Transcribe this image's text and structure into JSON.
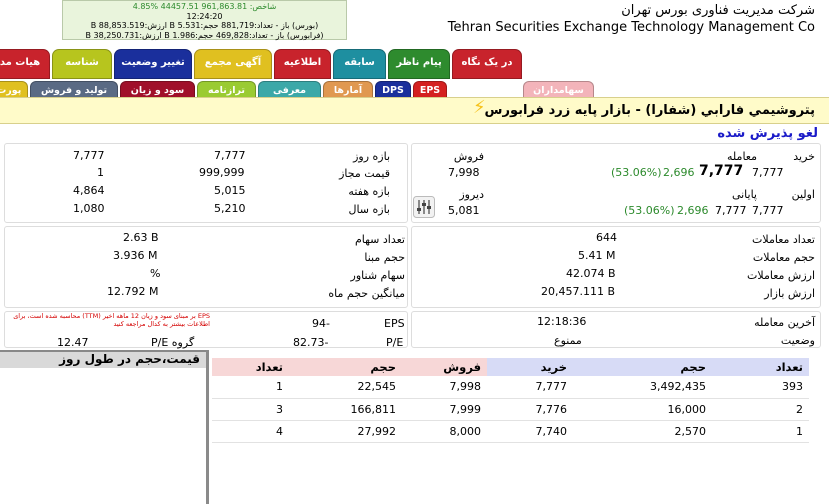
{
  "header": {
    "stats_line1": "شاخص: 961,863.81 44457.51 %4.85",
    "stats_line2": "12:24:20",
    "stats_line3": "(بورس) باز - تعداد:881,719 حجم:5.531 B ارزش:88,853.519 B",
    "stats_line4": "(فرابورس) باز - تعداد:469,828 حجم:1.986 B ارزش:38,250.731 B",
    "company_fa": "شرکت مدیریت فناوری بورس تهران",
    "company_en": "Tehran Securities Exchange Technology Management  Co"
  },
  "tabs_row1": [
    {
      "label": "در یک نگاه",
      "color": "#c8232c"
    },
    {
      "label": "پیام ناظر",
      "color": "#2e8b2e"
    },
    {
      "label": "سابقه",
      "color": "#1e8fa0"
    },
    {
      "label": "اطلاعیه",
      "color": "#c8232c"
    },
    {
      "label": "آگهی مجمع",
      "color": "#e0c020"
    },
    {
      "label": "تغییر وضعیت",
      "color": "#1a2f9c"
    },
    {
      "label": "شناسه",
      "color": "#b7c51e"
    },
    {
      "label": "هیات مد",
      "color": "#c8232c"
    }
  ],
  "tabs_row2": [
    {
      "label": "EPS",
      "color": "#d42020"
    },
    {
      "label": "DPS",
      "color": "#1a2f9c"
    },
    {
      "label": "آمارها",
      "color": "#e09850"
    },
    {
      "label": "معرفی",
      "color": "#3ca8a8"
    },
    {
      "label": "ترازنامه",
      "color": "#9acb32"
    },
    {
      "label": "سود و زیان",
      "color": "#a0102a"
    },
    {
      "label": "تولید و فروش",
      "color": "#5a6a84"
    },
    {
      "label": "پورت",
      "color": "#e0c020"
    },
    {
      "label": "سهامداران",
      "color": "#f3b4ba"
    }
  ],
  "title": "پتروشيمي فارابي (شفارا) - بازار پایه زرد فرابورس",
  "status_text": "لغو پذیرش شده",
  "prices": {
    "buy_label": "خرید",
    "buy_value": "7,777",
    "trade_label": "معامله",
    "trade_value": "7,777",
    "trade_change": "2,696",
    "trade_pct": "(53.06%)",
    "sell_label": "فروش",
    "sell_value": "7,998",
    "first_label": "اولین",
    "first_value": "7,777",
    "close_label": "پایانی",
    "close_value": "7,777",
    "close_change": "2,696",
    "close_pct": "(53.06%)",
    "yesterday_label": "دیروز",
    "yesterday_value": "5,081"
  },
  "ranges": {
    "day_label": "بازه روز",
    "day_low": "7,777",
    "day_high": "7,777",
    "allowed_label": "قیمت مجاز",
    "allowed_low": "999,999",
    "allowed_high": "1",
    "week_label": "بازه هفته",
    "week_low": "5,015",
    "week_high": "4,864",
    "year_label": "بازه سال",
    "year_low": "5,210",
    "year_high": "1,080"
  },
  "trading": {
    "count_label": "تعداد معاملات",
    "count_value": "644",
    "volume_label": "حجم معاملات",
    "volume_value": "5.41 M",
    "value_label": "ارزش معاملات",
    "value_value": "42.074 B",
    "mcap_label": "ارزش بازار",
    "mcap_value": "20,457.111 B"
  },
  "shares": {
    "shares_label": "تعداد سهام",
    "shares_value": "2.63 B",
    "base_label": "حجم مبنا",
    "base_value": "3.936 M",
    "float_label": "سهام شناور",
    "float_value": "%",
    "avg_label": "میانگین حجم ماه",
    "avg_value": "12.792 M"
  },
  "eps": {
    "label": "EPS",
    "value": "94-",
    "pe_label": "P/E",
    "pe_value": "82.73-",
    "group_pe_label": "P/E گروه",
    "group_pe_value": "12.47",
    "note": "EPS بر مبنای سود و زیان 12 ماهه اخیر (TTM) محاسبه شده است، برای اطلاعات بیشتر به کدال مراجعه کنید"
  },
  "status": {
    "last_trade_label": "آخرین معامله",
    "last_trade_value": "12:18:36",
    "state_label": "وضعیت",
    "state_value": "ممنوع"
  },
  "chart_panel_title": "قیمت،حجم در طول روز",
  "orderbook": {
    "headers": [
      "تعداد",
      "حجم",
      "فروش",
      "خرید",
      "حجم",
      "تعداد"
    ],
    "rows": [
      [
        "1",
        "22,545",
        "7,998",
        "7,777",
        "3,492,435",
        "393"
      ],
      [
        "3",
        "166,811",
        "7,999",
        "7,776",
        "16,000",
        "2"
      ],
      [
        "4",
        "27,992",
        "8,000",
        "7,740",
        "2,570",
        "1"
      ]
    ]
  },
  "colors": {
    "accent_blue": "#1a1ac8",
    "title_bg": "#fffbc9",
    "green": "#2c8a2c",
    "red": "#d40000"
  }
}
